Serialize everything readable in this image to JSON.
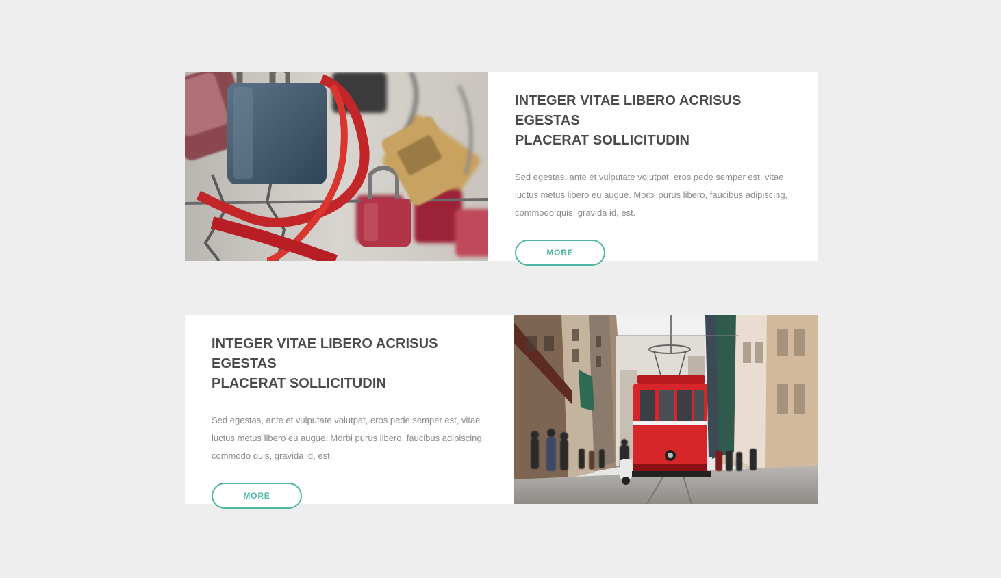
{
  "articles": [
    {
      "title_line1": "INTEGER VITAE LIBERO ACRISUS EGESTAS",
      "title_line2": "PLACERAT SOLLICITUDIN",
      "description": "Sed egestas, ante et vulputate volutpat, eros pede semper est, vitae luctus metus libero eu augue. Morbi purus libero, faucibus adipiscing, commodo quis, gravida id, est.",
      "button_label": "MORE",
      "image": "padlocks-photo"
    },
    {
      "title_line1": "INTEGER VITAE LIBERO ACRISUS EGESTAS",
      "title_line2": "PLACERAT SOLLICITUDIN",
      "description": "Sed egestas, ante et vulputate volutpat, eros pede semper est, vitae luctus metus libero eu augue. Morbi purus libero, faucibus adipiscing, commodo quis, gravida id, est.",
      "button_label": "MORE",
      "image": "red-tram-street-photo"
    }
  ],
  "colors": {
    "page_background": "#eeeeee",
    "card_background": "#ffffff",
    "title_text": "#4a4a4a",
    "body_text": "#8a8a8a",
    "accent": "#4db6a4"
  }
}
